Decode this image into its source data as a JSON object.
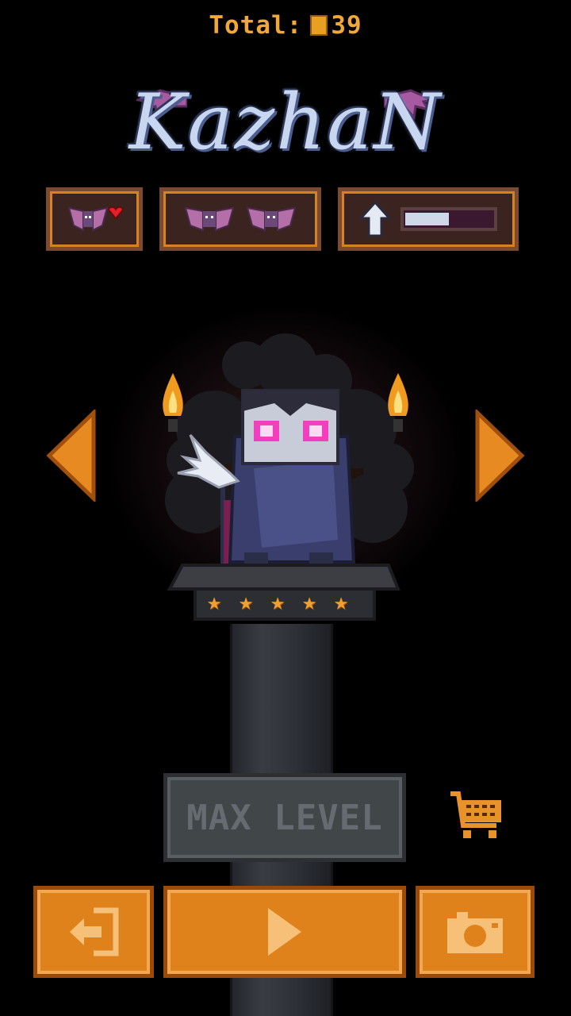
{
  "hud": {
    "total_label": "Total:",
    "total_value": "39",
    "coin_icon": "coin-icon"
  },
  "character": {
    "name": "KazhaN",
    "stars": 5
  },
  "stats": {
    "upgrade_progress": 0.5
  },
  "controls": {
    "max_level_label": "MAX LEVEL"
  },
  "colors": {
    "accent": "#e0821c",
    "title": "#c9d6ef",
    "star": "#f0a030"
  }
}
